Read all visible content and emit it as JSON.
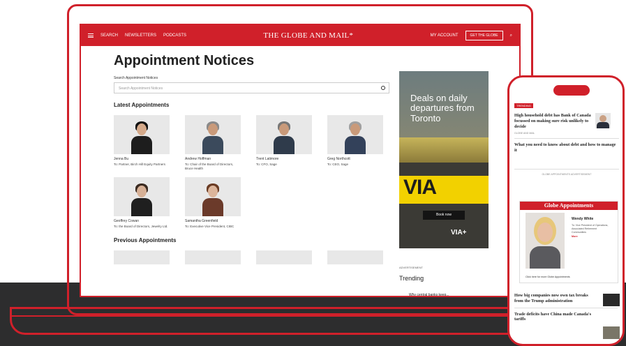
{
  "laptop": {
    "nav": {
      "left_items": [
        "SEARCH",
        "NEWSLETTERS",
        "PODCASTS"
      ],
      "logo": "THE GLOBE AND MAIL*",
      "account": "MY ACCOUNT",
      "subscribe": "GET THE GLOBE"
    },
    "page_title": "Appointment Notices",
    "search": {
      "label": "Search Appointment Notices",
      "placeholder": "Search Appointment Notices"
    },
    "latest_heading": "Latest Appointments",
    "appointments": [
      {
        "name": "Jenna Bu",
        "role": "To: Partner, Birch Hill Equity Partners"
      },
      {
        "name": "Andrew Hoffman",
        "role": "To: Chair of the Board of Directors, Bruce Health"
      },
      {
        "name": "Trent Latimore",
        "role": "To: CFO, Sage"
      },
      {
        "name": "Greg Northcott",
        "role": "To: CEO, Sage"
      },
      {
        "name": "Geoffrey Cowan",
        "role": "To: the Board of Directors, Jewelry Ltd."
      },
      {
        "name": "Samantha Greenfield",
        "role": "To: Executive Vice President, CIBC"
      }
    ],
    "previous_heading": "Previous Appointments",
    "ad": {
      "headline": "Deals on daily departures from Toronto",
      "brand": "VIA",
      "cta": "Book now",
      "logo": "VIA+"
    },
    "ad_label": "ADVERTISEMENT",
    "trending_heading": "Trending",
    "trending_item": "Why central banks keep..."
  },
  "phone": {
    "tag": "TRENDING",
    "headline1": "High household debt has Bank of Canada focussed on making sure risk unlikely to decide",
    "meta1": "GLOBE AND MAIL",
    "headline2": "What you need to know about debt and how to manage it",
    "ad_label": "GLOBE APPOINTMENTS ADVERTISEMENT",
    "box_title": "Globe Appointments",
    "box_name": "Wendy White",
    "box_text": "To: Vice President of Operations, Associated Retirement Communities",
    "box_more": "More",
    "box_link": "Click here for more Globe Appointments",
    "headline3": "How big companies now own tax breaks from the Trump administration",
    "headline4": "Trade deficits have China made Canada's tariffs"
  },
  "colors": {
    "brand_red": "#d0202a",
    "dark_band": "#2d2d2e"
  }
}
